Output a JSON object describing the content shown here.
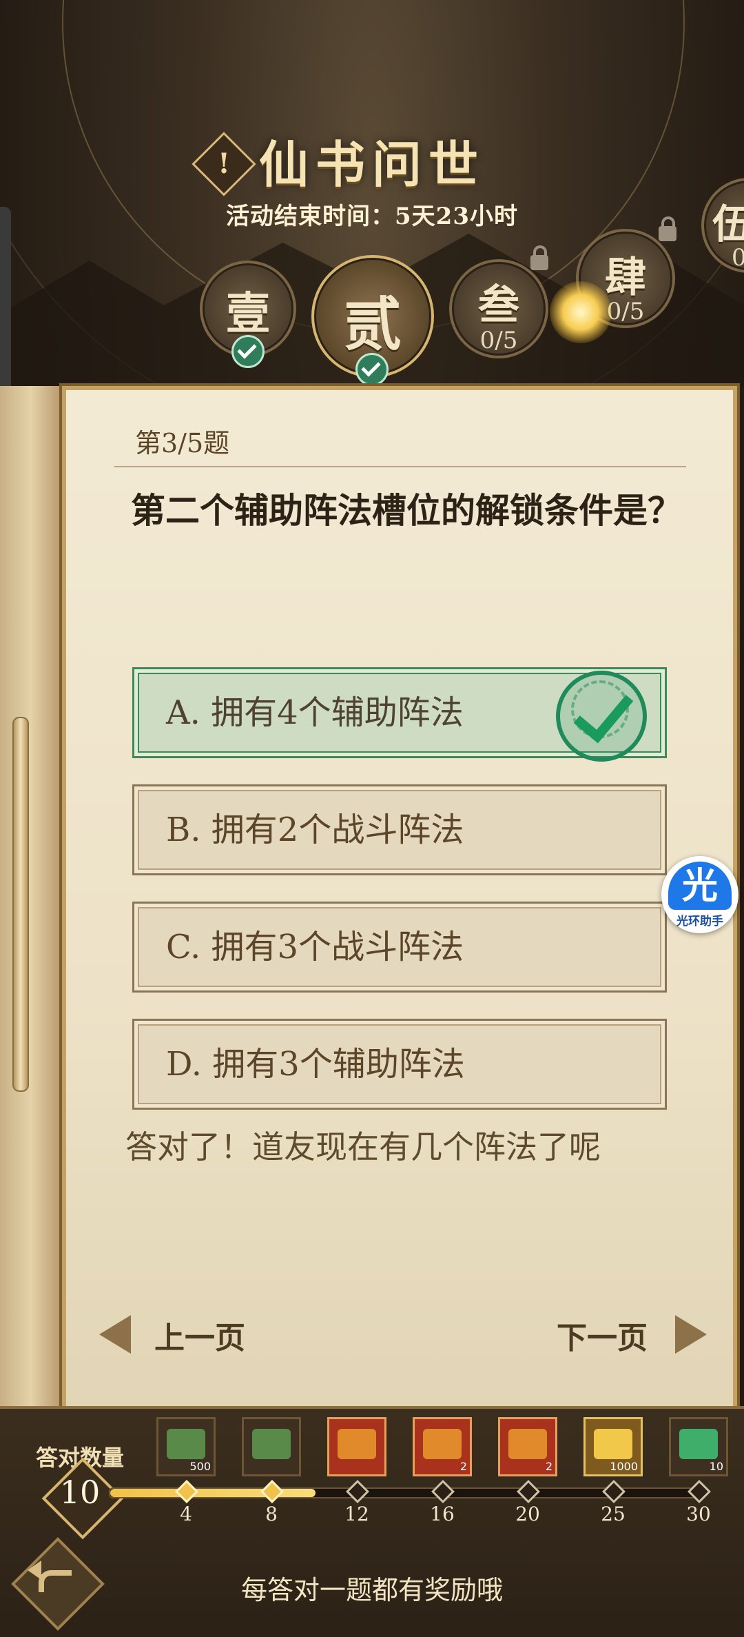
{
  "header": {
    "title": "仙书问世",
    "info_glyph": "!",
    "timer_text": "活动结束时间：5天23小时"
  },
  "chapters": [
    {
      "label": "壹",
      "count": "",
      "state": "complete"
    },
    {
      "label": "贰",
      "count": "",
      "state": "active-complete"
    },
    {
      "label": "叁",
      "count": "0/5",
      "state": "locked"
    },
    {
      "label": "肆",
      "count": "0/5",
      "state": "locked"
    },
    {
      "label": "伍",
      "count": "0",
      "state": "locked"
    }
  ],
  "question": {
    "counter": "第3/5题",
    "text": "第二个辅助阵法槽位的解锁条件是？",
    "options": [
      {
        "label": "A. 拥有4个辅助阵法",
        "correct": true
      },
      {
        "label": "B. 拥有2个战斗阵法",
        "correct": false
      },
      {
        "label": "C. 拥有3个战斗阵法",
        "correct": false
      },
      {
        "label": "D. 拥有3个辅助阵法",
        "correct": false
      }
    ],
    "feedback": "答对了！道友现在有几个阵法了呢"
  },
  "nav": {
    "prev_label": "上一页",
    "next_label": "下一页"
  },
  "helper": {
    "glyph": "光",
    "caption": "光环助手"
  },
  "progress": {
    "label": "答对数量",
    "count": "10",
    "current": 10,
    "milestones": [
      {
        "value": "4",
        "reward": "green-chest-icon",
        "qty": "500",
        "style": "dark"
      },
      {
        "value": "8",
        "reward": "green-chest-icon",
        "qty": "",
        "style": "dark"
      },
      {
        "value": "12",
        "reward": "red-chest-icon",
        "qty": "",
        "style": "red"
      },
      {
        "value": "16",
        "reward": "red-chest-icon",
        "qty": "2",
        "style": "red"
      },
      {
        "value": "20",
        "reward": "red-chest-icon",
        "qty": "2",
        "style": "red"
      },
      {
        "value": "25",
        "reward": "gold-ingot-icon",
        "qty": "1000",
        "style": "gold"
      },
      {
        "value": "30",
        "reward": "jade-orb-icon",
        "qty": "10",
        "style": "dark"
      }
    ]
  },
  "footer": {
    "text": "每答对一题都有奖励哦"
  },
  "colors": {
    "correct_green": "#3d8a55",
    "paper": "#f3ead4",
    "gold": "#d9b66f"
  }
}
